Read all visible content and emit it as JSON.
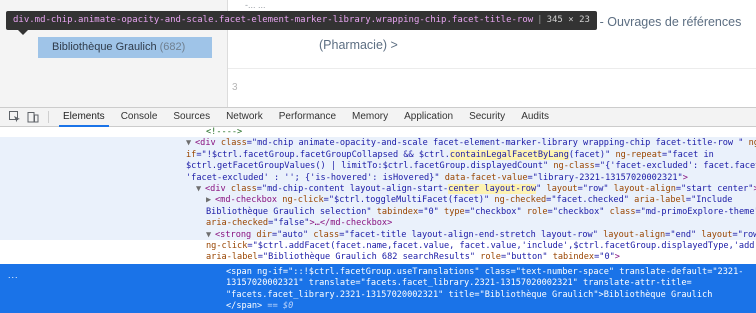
{
  "page": {
    "header_fragment": "-... ...",
    "facet_chip_label": "Bibliothèque Graulich",
    "facet_chip_count": "(682)",
    "link_fragment_1": "ie  Libre accès - Ouvrages de références",
    "link_fragment_2": "(Pharmacie)  >",
    "fragment_3": "3"
  },
  "tooltip": {
    "selector": "div.md-chip.animate-opacity-and-scale.facet-element-marker-library.wrapping-chip.facet-title-row",
    "dimensions": "345 × 23"
  },
  "toolbar": {
    "inspect_icon": "inspect-element-icon",
    "device_icon": "device-toolbar-icon",
    "tabs": [
      {
        "label": "Elements",
        "active": true
      },
      {
        "label": "Console",
        "active": false
      },
      {
        "label": "Sources",
        "active": false
      },
      {
        "label": "Network",
        "active": false
      },
      {
        "label": "Performance",
        "active": false
      },
      {
        "label": "Memory",
        "active": false
      },
      {
        "label": "Application",
        "active": false
      },
      {
        "label": "Security",
        "active": false
      },
      {
        "label": "Audits",
        "active": false
      }
    ]
  },
  "dom": {
    "l0": "<!---->",
    "l1a": "<div ",
    "l1b": "class",
    "l1c": "=\"md-chip animate-opacity-and-scale facet-element-marker-library wrapping-chip facet-title-row \"",
    "l1d": " ng",
    "l2a": "if",
    "l2b": "=\"!$ctrl.facetGroup.facetGroupCollapsed && $ctrl.",
    "l2c": "containLegalFacetByLang",
    "l2d": "(facet)\"",
    "l2e": " ng-repeat",
    "l2f": "=\"facet in",
    "l3a": "$ctrl.getFacetGroupValues() | limitTo:$ctrl.facetGroup.displayedCount\"",
    "l3b": " ng-class",
    "l3c": "=\"{'facet-excluded': facet.facetType==='exclude' ?",
    "l4a": "'facet-excluded' : ''; {'is-hovered': isHovered}\"",
    "l4b": " data-facet-value",
    "l4c": "=\"library-2321-13157020002321\"",
    "l4d": ">",
    "l5a": "<div ",
    "l5b": "class",
    "l5c": "=\"md-chip-content layout-align-start-",
    "l5d": "center layout-row",
    "l5e": "\"",
    "l5f": " layout",
    "l5g": "=\"row\"",
    "l5h": " layout-align",
    "l5i": "=\"start center\"",
    "l5j": ">",
    "l6a": "<md-checkbox ",
    "l6b": "ng-click",
    "l6c": "=\"$ctrl.toggleMultiFacet(facet)\"",
    "l6d": " ng-checked",
    "l6e": "=\"facet.checked\"",
    "l6f": " aria-label",
    "l6g": "=\"Include",
    "l7a": "Bibliothèque Graulich selection\"",
    "l7b": " tabindex",
    "l7c": "=\"0\"",
    "l7d": " type",
    "l7e": "=\"checkbox\"",
    "l7f": " role",
    "l7g": "=\"checkbox\"",
    "l7h": " class",
    "l7i": "=\"md-primoExplore-theme\"",
    "l8a": "aria-checked",
    "l8b": "=\"false\"",
    "l8c": ">…</md-checkbox>",
    "l9a": "<strong ",
    "l9b": "dir",
    "l9c": "=\"auto\"",
    "l9d": " class",
    "l9e": "=\"facet-title layout-align-end-stretch layout-row\"",
    "l9f": " layout-align",
    "l9g": "=\"end\"",
    "l9h": " layout",
    "l9i": "=\"row\"",
    "l10a": "ng-click",
    "l10b": "=\"$ctrl.addFacet(facet.name,facet.value, facet.value,'include',$ctrl.facetGroup.displayedType,'add'",
    "l11a": "aria-label",
    "l11b": "=\"Bibliothèque Graulich 682 searchResults\"",
    "l11c": " role",
    "l11d": "=\"button\"",
    "l11e": " tabindex",
    "l11f": "=\"0\"",
    "l11g": ">",
    "l12": "<!---->",
    "l13": "<!---->",
    "s1a": "<span ",
    "s1b": "ng-if",
    "s1c": "=\"::!$ctrl.facetGroup.useTranslations\"",
    "s1d": " class",
    "s1e": "=\"text-number-space\"",
    "s1f": " translate-default",
    "s1g": "=\"2321-",
    "s2a": "13157020002321\"",
    "s2b": " translate",
    "s2c": "=\"facets.facet_library.2321-13157020002321\"",
    "s2d": " translate-attr-title",
    "s2e": "=",
    "s3a": "\"facets.facet_library.2321-13157020002321\"",
    "s3b": " title",
    "s3c": "=\"Bibliothèque Graulich\"",
    "s3d": ">Bibliothèque Graulich",
    "s4a": "</span>",
    "s4b": " == $0",
    "dots": "..."
  }
}
